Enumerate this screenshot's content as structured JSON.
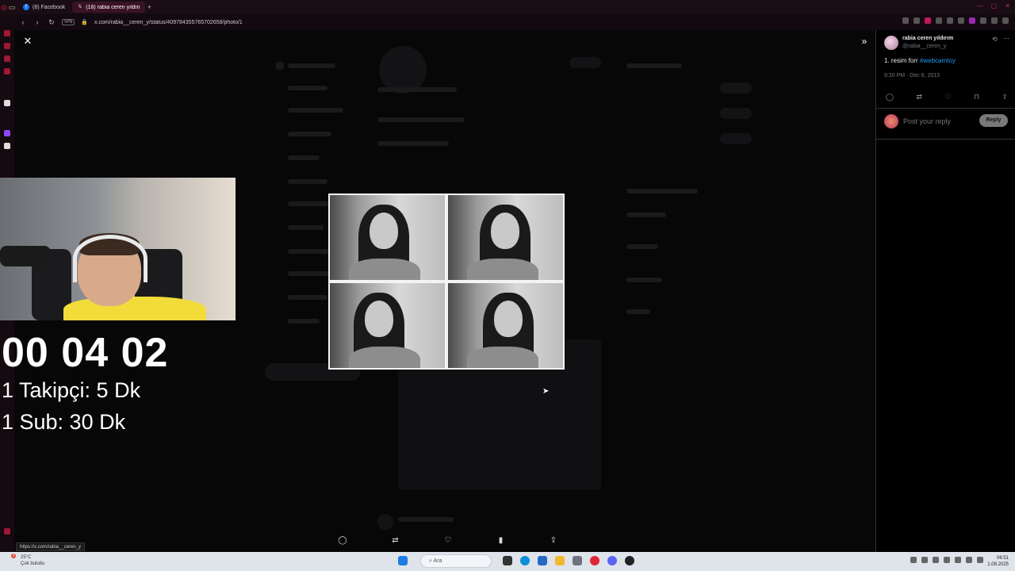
{
  "browser": {
    "tabs": [
      {
        "label": "(8) Facebook",
        "active": false
      },
      {
        "label": "(18) rabia ceren yıldırım (",
        "active": true
      }
    ],
    "url": "x.com/rabia__ceren_y/status/409784355765702658/photo/1",
    "vpn_label": "VPN",
    "status_url": "https://x.com/rabia__ceren_y"
  },
  "stream_overlay": {
    "timer": "00 04 02",
    "follower_line": "1 Takipçi: 5 Dk",
    "sub_line": "1 Sub: 30 Dk"
  },
  "tweet": {
    "author_name": "rabia ceren yıldırım",
    "author_handle": "@rabia__ceren_y",
    "text_prefix": "1. resim forr ",
    "hashtag": "#webcamtoy",
    "timestamp": "9:20 PM · Dec 8, 2013",
    "reply_placeholder": "Post your reply",
    "reply_button": "Reply"
  },
  "taskbar": {
    "weather_temp": "25°C",
    "weather_desc": "Çok bulutlu",
    "weather_badge": "3",
    "search_label": "Ara",
    "time": "06:51",
    "date": "1.08.2025"
  },
  "colors": {
    "accent_blue": "#1d9bf0",
    "overlay_text": "#ffffff",
    "shirt_yellow": "#f2dc39"
  }
}
